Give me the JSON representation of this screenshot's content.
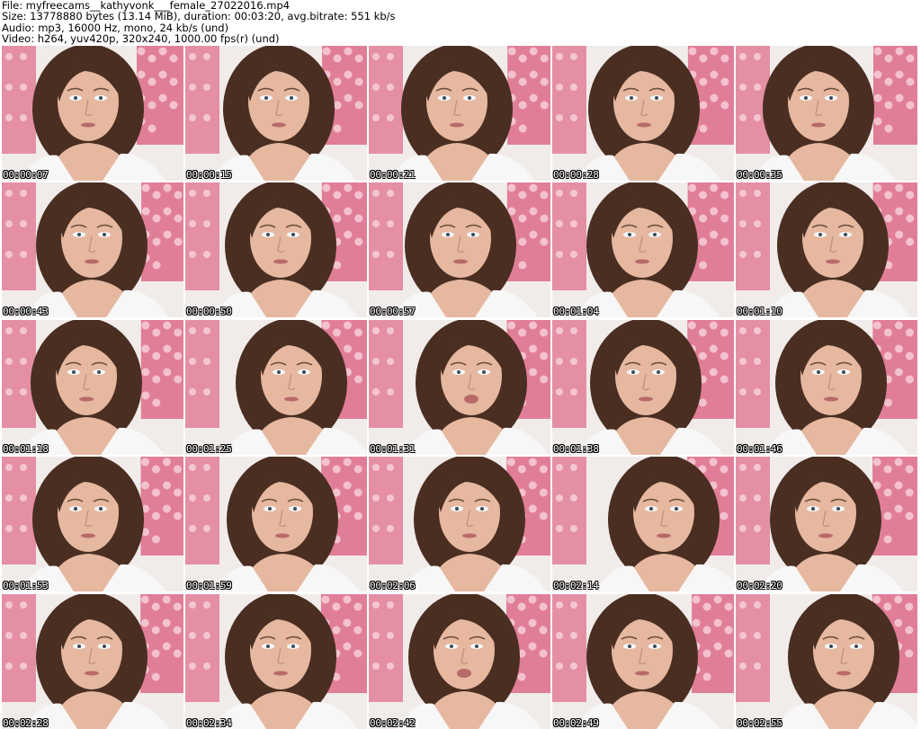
{
  "header": {
    "file": "File: myfreecams__kathyvonk___female_27022016.mp4",
    "size": "Size: 13778880 bytes (13.14 MiB), duration: 00:03:20, avg.bitrate: 551 kb/s",
    "audio": "Audio: mp3, 16000 Hz, mono, 24 kb/s (und)",
    "video": "Video: h264, yuv420p, 320x240, 1000.00 fps(r) (und)"
  },
  "thumbnails": [
    "00:00:07",
    "00:00:15",
    "00:00:21",
    "00:00:28",
    "00:00:35",
    "00:00:43",
    "00:00:50",
    "00:00:57",
    "00:01:04",
    "00:01:10",
    "00:01:18",
    "00:01:25",
    "00:01:31",
    "00:01:38",
    "00:01:46",
    "00:01:53",
    "00:01:59",
    "00:02:06",
    "00:02:14",
    "00:02:20",
    "00:02:28",
    "00:02:34",
    "00:02:42",
    "00:02:49",
    "00:02:55"
  ],
  "colors": {
    "background": "#ffffff",
    "wall": "#f1ecea",
    "pattern": "#d9446a",
    "hair": "#4a2e22",
    "skin": "#e6b8a0",
    "top": "#f7f7f7"
  }
}
